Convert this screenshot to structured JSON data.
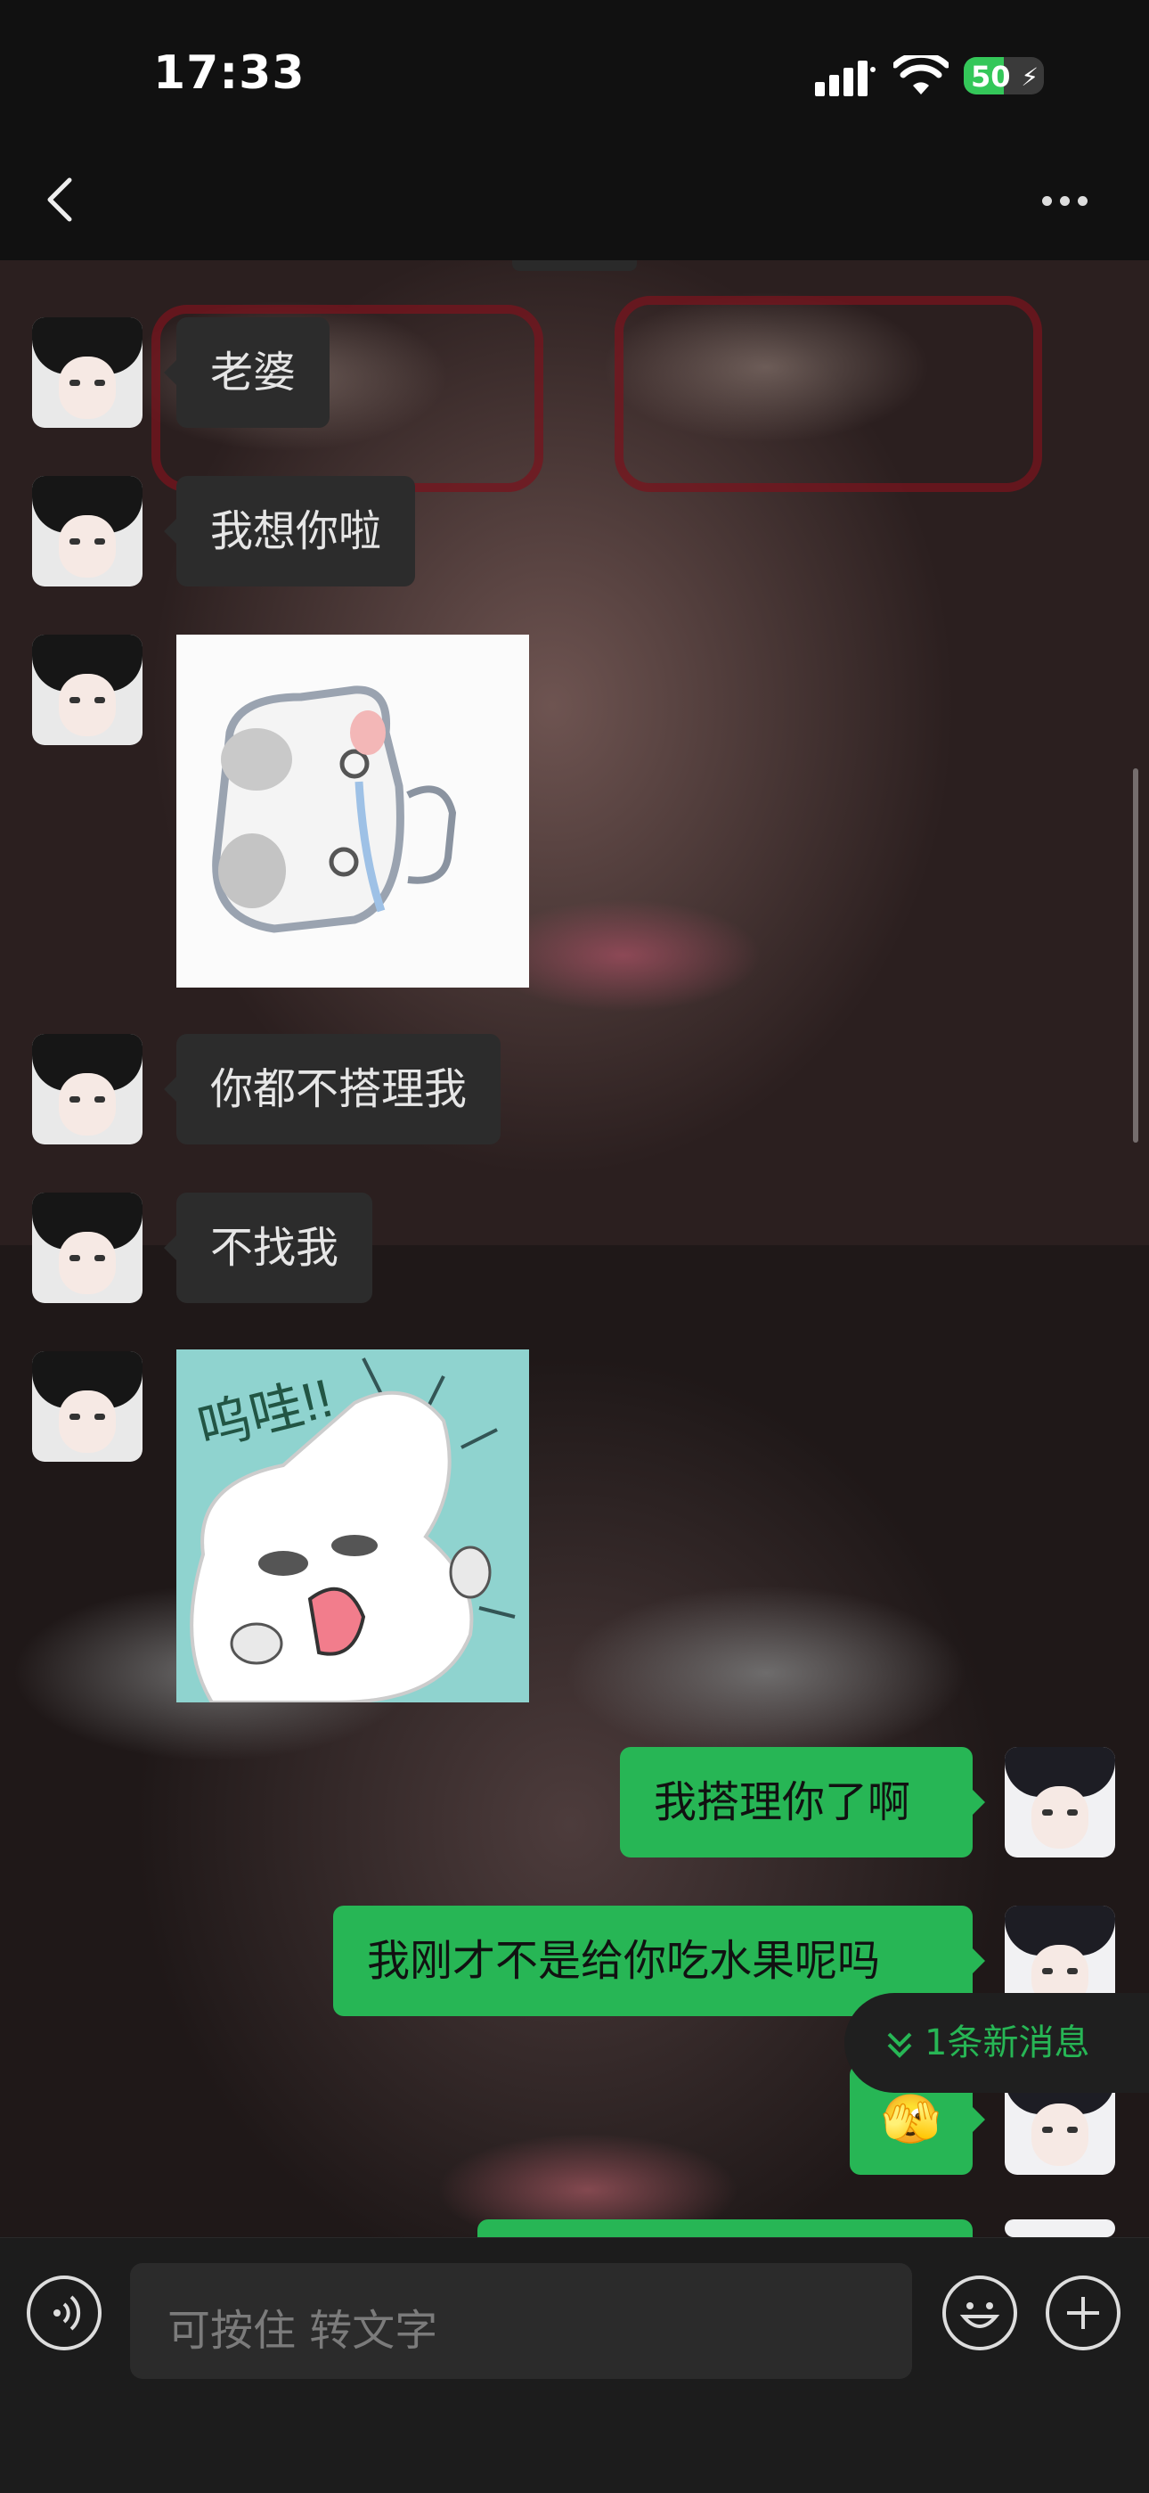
{
  "status_bar": {
    "time": "17:33",
    "battery_level": "50",
    "battery_fill": 0.5
  },
  "nav": {
    "title": "",
    "back_icon": "chevron-left-icon",
    "more_icon": "ellipsis-icon"
  },
  "messages": [
    {
      "side": "in",
      "type": "text",
      "text": "老婆"
    },
    {
      "side": "in",
      "type": "text",
      "text": "我想你啦"
    },
    {
      "side": "in",
      "type": "sticker",
      "text": ""
    },
    {
      "side": "in",
      "type": "text",
      "text": "你都不搭理我"
    },
    {
      "side": "in",
      "type": "text",
      "text": "不找我"
    },
    {
      "side": "in",
      "type": "sticker",
      "text": "呜哇!!"
    },
    {
      "side": "out",
      "type": "text",
      "text": "我搭理你了啊"
    },
    {
      "side": "out",
      "type": "text",
      "text": "我刚才不是给你吃水果呢吗"
    },
    {
      "side": "out",
      "type": "emoji",
      "text": "🫣"
    }
  ],
  "new_message_banner": {
    "label": "1条新消息"
  },
  "input_bar": {
    "placeholder": "可按住 转文字"
  },
  "colors": {
    "outgoing_bubble": "#27b655",
    "incoming_bubble": "#2c2c2c",
    "background": "#111111"
  }
}
